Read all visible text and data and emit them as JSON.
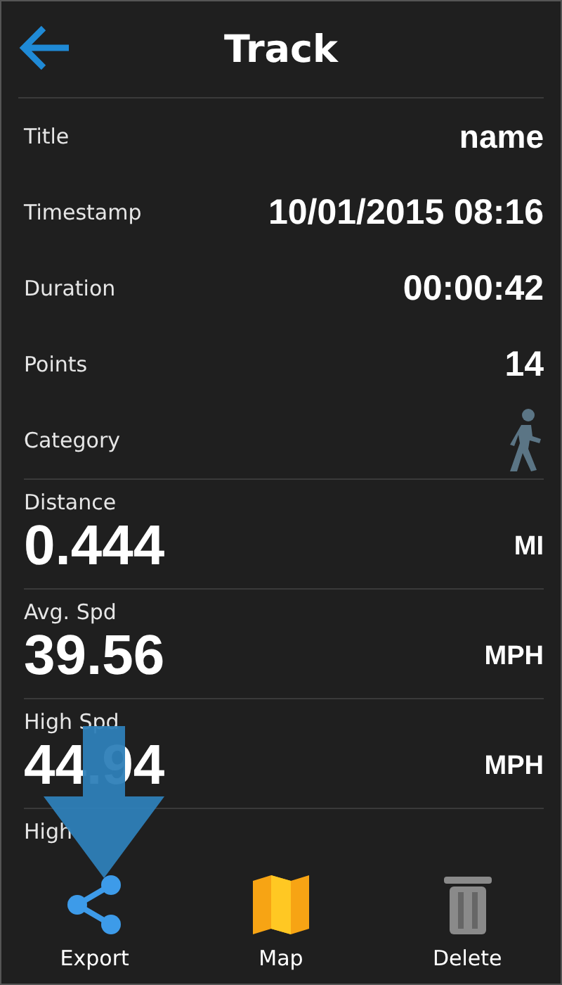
{
  "header": {
    "title": "Track"
  },
  "fields": [
    {
      "label": "Title",
      "value": "name",
      "kind": "text"
    },
    {
      "label": "Timestamp",
      "value": "10/01/2015 08:16",
      "kind": "text"
    },
    {
      "label": "Duration",
      "value": "00:00:42",
      "kind": "text"
    },
    {
      "label": "Points",
      "value": "14",
      "kind": "text"
    },
    {
      "label": "Category",
      "kind": "icon"
    }
  ],
  "stats": [
    {
      "label": "Distance",
      "value": "0.444",
      "unit": "MI"
    },
    {
      "label": "Avg. Spd",
      "value": "39.56",
      "unit": "MPH"
    },
    {
      "label": "High Spd",
      "value": "44.94",
      "unit": "MPH"
    },
    {
      "label": "High"
    }
  ],
  "toolbar": [
    {
      "label": "Export",
      "kind": "share"
    },
    {
      "label": "Map",
      "kind": "map"
    },
    {
      "label": "Delete",
      "kind": "trash"
    }
  ]
}
